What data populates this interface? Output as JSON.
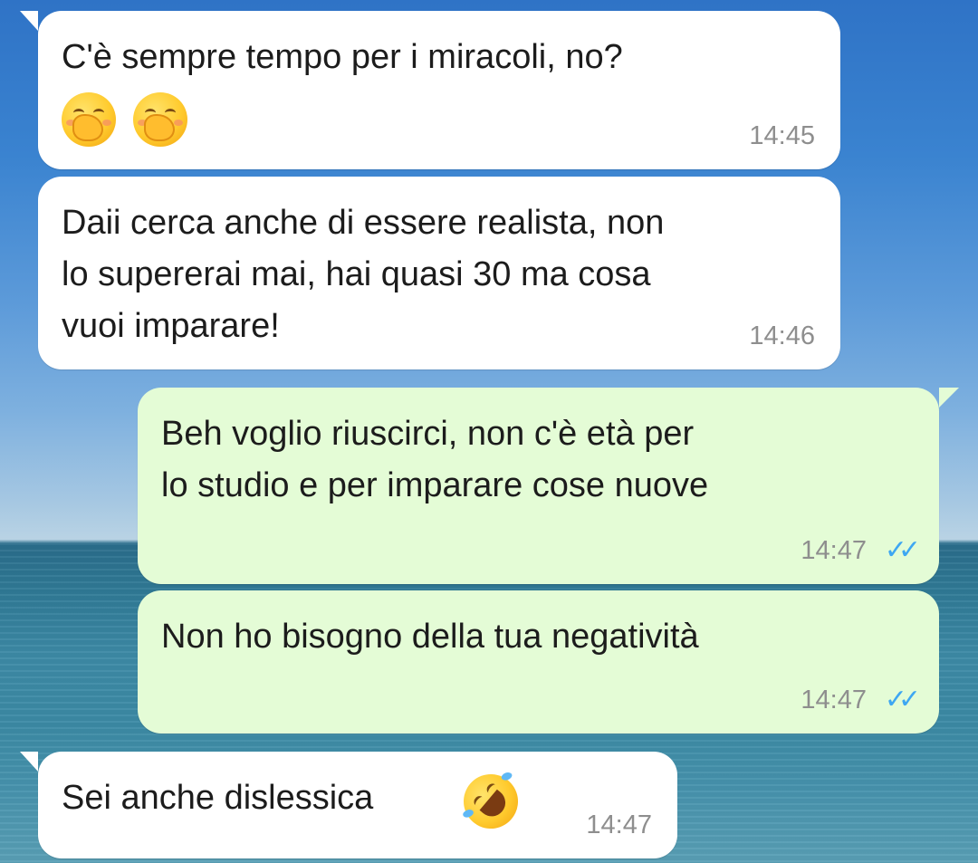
{
  "conversation": {
    "messages": [
      {
        "direction": "incoming",
        "text": "C'è sempre tempo per i miracoli, no?",
        "emoji": [
          "hand-over-mouth-emoji",
          "hand-over-mouth-emoji"
        ],
        "time": "14:45"
      },
      {
        "direction": "incoming",
        "text": "Daii cerca anche di essere realista, non\nlo supererai mai, hai quasi 30 ma cosa\nvuoi imparare!",
        "time": "14:46"
      },
      {
        "direction": "outgoing",
        "text": "Beh voglio riuscirci, non c'è età per\nlo studio e per imparare cose nuove",
        "time": "14:47",
        "status": "read"
      },
      {
        "direction": "outgoing",
        "text": "Non ho bisogno della tua negatività",
        "time": "14:47",
        "status": "read"
      },
      {
        "direction": "incoming",
        "text": "Sei anche dislessica",
        "emoji": [
          "rolling-on-floor-laughing-emoji"
        ],
        "time": "14:47"
      }
    ]
  },
  "theme": {
    "incoming_bubble": "#ffffff",
    "outgoing_bubble": "#e4fcd6",
    "read_ticks": "#3ea7f2",
    "timestamp": "#8e8e8e",
    "wallpaper": "sky-and-sea"
  },
  "icons": {
    "read_receipt": "double-check-icon"
  }
}
